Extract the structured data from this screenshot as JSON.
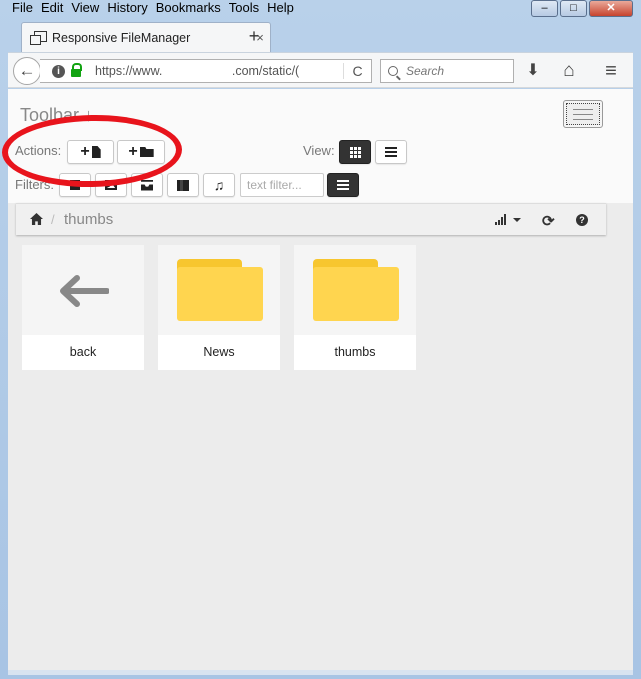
{
  "menu": [
    "File",
    "Edit",
    "View",
    "History",
    "Bookmarks",
    "Tools",
    "Help"
  ],
  "window_controls": [
    "–",
    "□",
    "✕"
  ],
  "tab": {
    "title": "Responsive FileManager",
    "close": "×",
    "new_tab": "+"
  },
  "nav": {
    "back": "←",
    "info": "i",
    "url": "https://www.                    .com/static/(",
    "reload": "C",
    "search_placeholder": "Search",
    "download": "⬇",
    "home": "⌂",
    "menu": "≡"
  },
  "toolbar": {
    "title": "Toolbar ↓",
    "actions_label": "Actions:",
    "view_label": "View:",
    "filters_label": "Filters:",
    "filter_placeholder": "text filter...",
    "upload_plus": "+",
    "folder_plus": "+"
  },
  "breadcrumb": {
    "separator": "/",
    "current": "thumbs",
    "refresh": "⟳",
    "help": "?"
  },
  "items": [
    {
      "name": "back",
      "type": "back"
    },
    {
      "name": "News",
      "type": "folder"
    },
    {
      "name": "thumbs",
      "type": "folder"
    }
  ],
  "colors": {
    "folder": "#ffd54f",
    "annotation": "#e8141c"
  }
}
